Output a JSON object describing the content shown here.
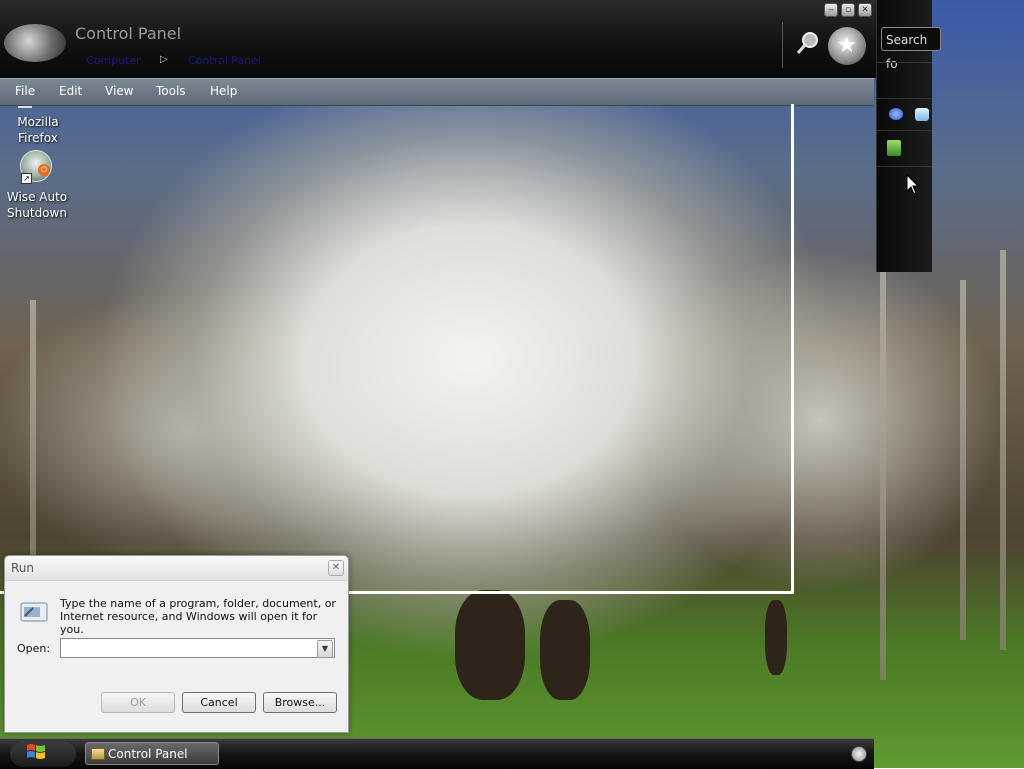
{
  "window": {
    "title": "Control Panel",
    "breadcrumb": [
      "Computer",
      "Control Panel"
    ],
    "breadcrumb_separator": "▷",
    "buttons": {
      "minimize": "‒",
      "restore": "▫",
      "close": "✕"
    }
  },
  "menubar": {
    "items": [
      "File",
      "Edit",
      "View",
      "Tools",
      "Help"
    ]
  },
  "sidebar": {
    "search_text": "Search fo"
  },
  "desktop": {
    "icons": [
      {
        "label_line1": "Mozilla",
        "label_line2": "Firefox"
      },
      {
        "label_line1": "Wise Auto",
        "label_line2": "Shutdown"
      }
    ],
    "shortcut_glyph": "↗"
  },
  "run_dialog": {
    "title": "Run",
    "close_glyph": "✕",
    "description": "Type the name of a program, folder, document, or Internet resource, and Windows will open it for you.",
    "open_label": "Open:",
    "open_value": "",
    "buttons": {
      "ok": "OK",
      "cancel": "Cancel",
      "browse": "Browse..."
    },
    "combo_arrow": "▼"
  },
  "taskbar": {
    "items": [
      {
        "label": "Control Panel"
      }
    ]
  },
  "icons": {
    "star": "★"
  }
}
